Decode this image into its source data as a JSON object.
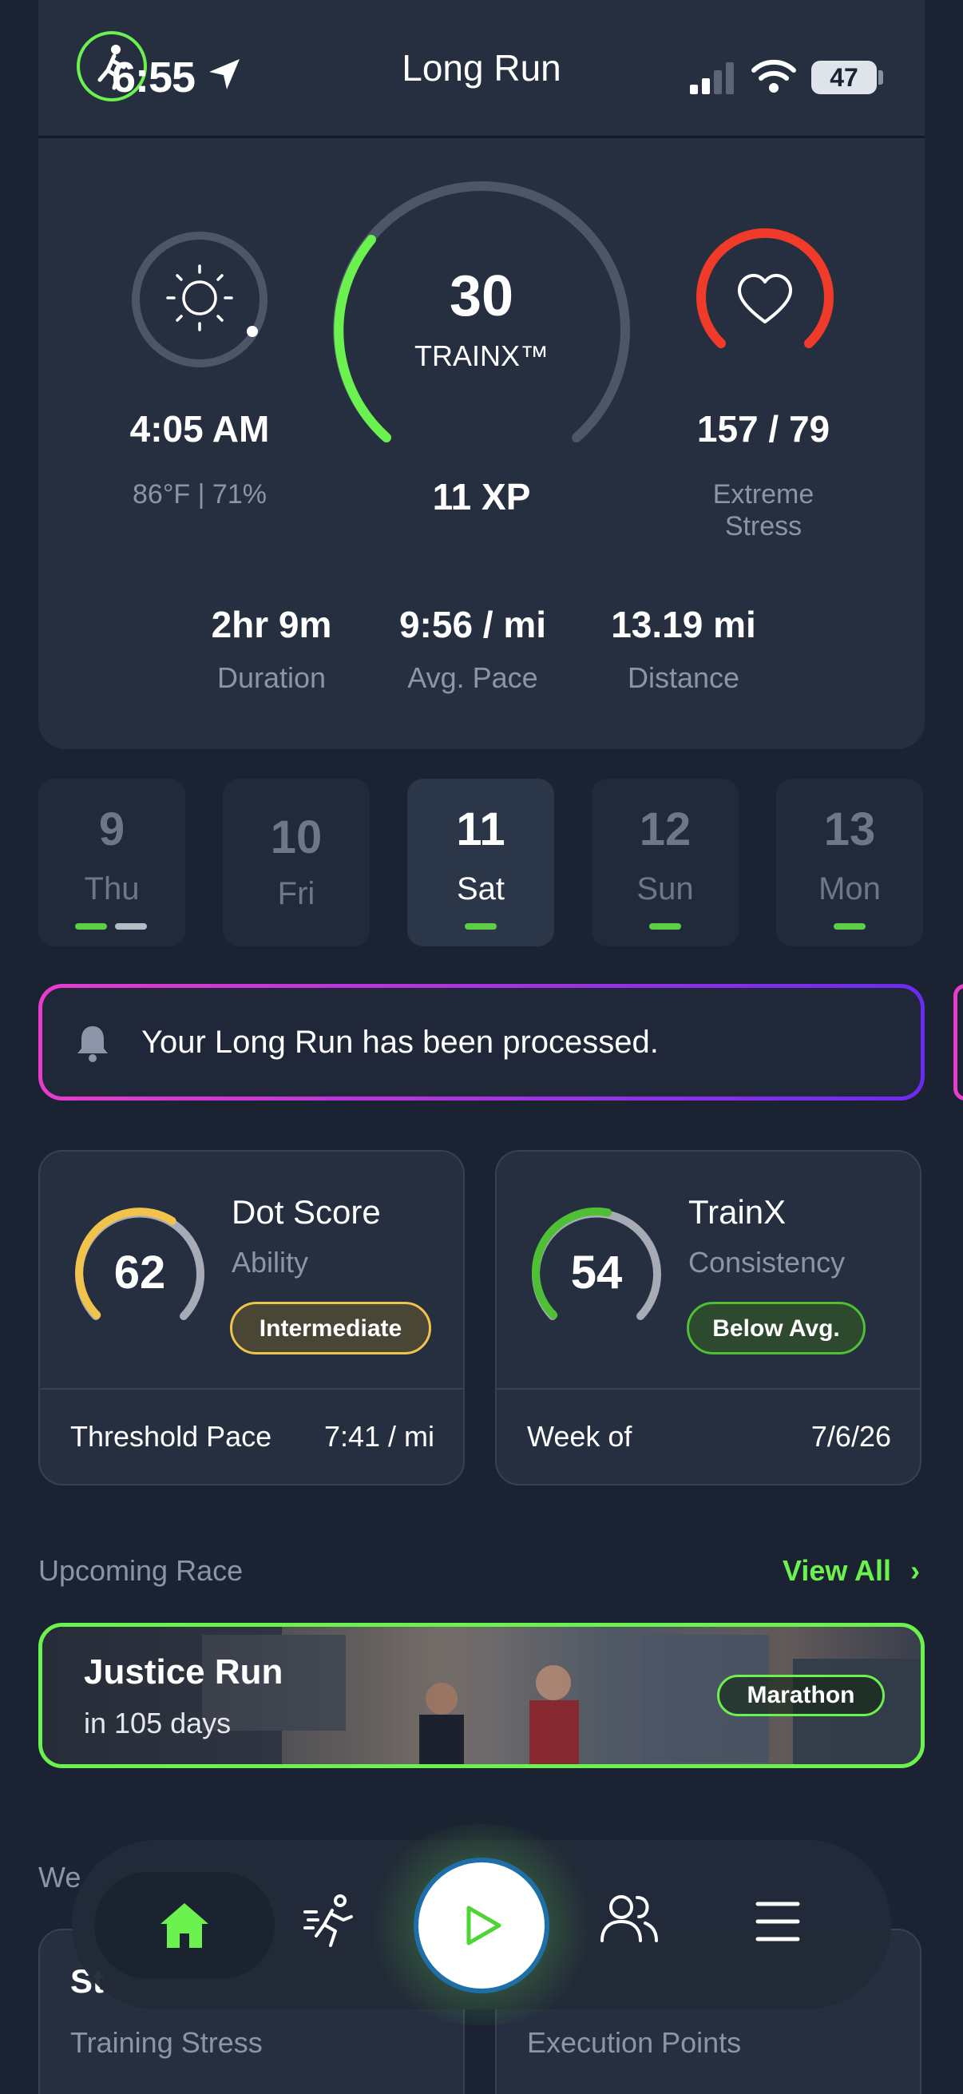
{
  "status_bar": {
    "time": "6:55",
    "battery": "47"
  },
  "header": {
    "title": "Long Run"
  },
  "summary": {
    "time": {
      "value": "4:05 AM",
      "weather": "86°F | 71%"
    },
    "score": {
      "value": "30",
      "label": "TRAINX™",
      "xp": "11 XP"
    },
    "heart": {
      "value": "157 / 79",
      "label_line1": "Extreme",
      "label_line2": "Stress"
    },
    "stats": [
      {
        "value": "2hr 9m",
        "label": "Duration"
      },
      {
        "value": "9:56 / mi",
        "label": "Avg. Pace"
      },
      {
        "value": "13.19 mi",
        "label": "Distance"
      }
    ]
  },
  "days": [
    {
      "num": "9",
      "name": "Thu"
    },
    {
      "num": "10",
      "name": "Fri"
    },
    {
      "num": "11",
      "name": "Sat"
    },
    {
      "num": "12",
      "name": "Sun"
    },
    {
      "num": "13",
      "name": "Mon"
    }
  ],
  "notification": {
    "text": "Your Long Run has been processed."
  },
  "dot_score": {
    "value": "62",
    "title": "Dot Score",
    "subtitle": "Ability",
    "badge": "Intermediate",
    "footer_label": "Threshold Pace",
    "footer_value": "7:41 / mi",
    "level": 0.62
  },
  "trainx": {
    "value": "54",
    "title": "TrainX",
    "subtitle": "Consistency",
    "badge": "Below Avg.",
    "footer_label": "Week of",
    "footer_value": "7/6/26",
    "level": 0.54
  },
  "upcoming": {
    "label": "Upcoming Race",
    "view_all": "View All",
    "race": {
      "title": "Justice Run",
      "subtitle": "in 105 days",
      "tag": "Marathon"
    }
  },
  "weekly": {
    "label_partial": "We",
    "card1": {
      "title_partial": "St",
      "label": "Training Stress"
    },
    "card2": {
      "label": "Execution Points"
    }
  },
  "colors": {
    "accent": "#6cf24f",
    "background": "#1b2332",
    "card": "#252f40",
    "heart": "#f03a2a",
    "dot": "#f2c34c"
  }
}
